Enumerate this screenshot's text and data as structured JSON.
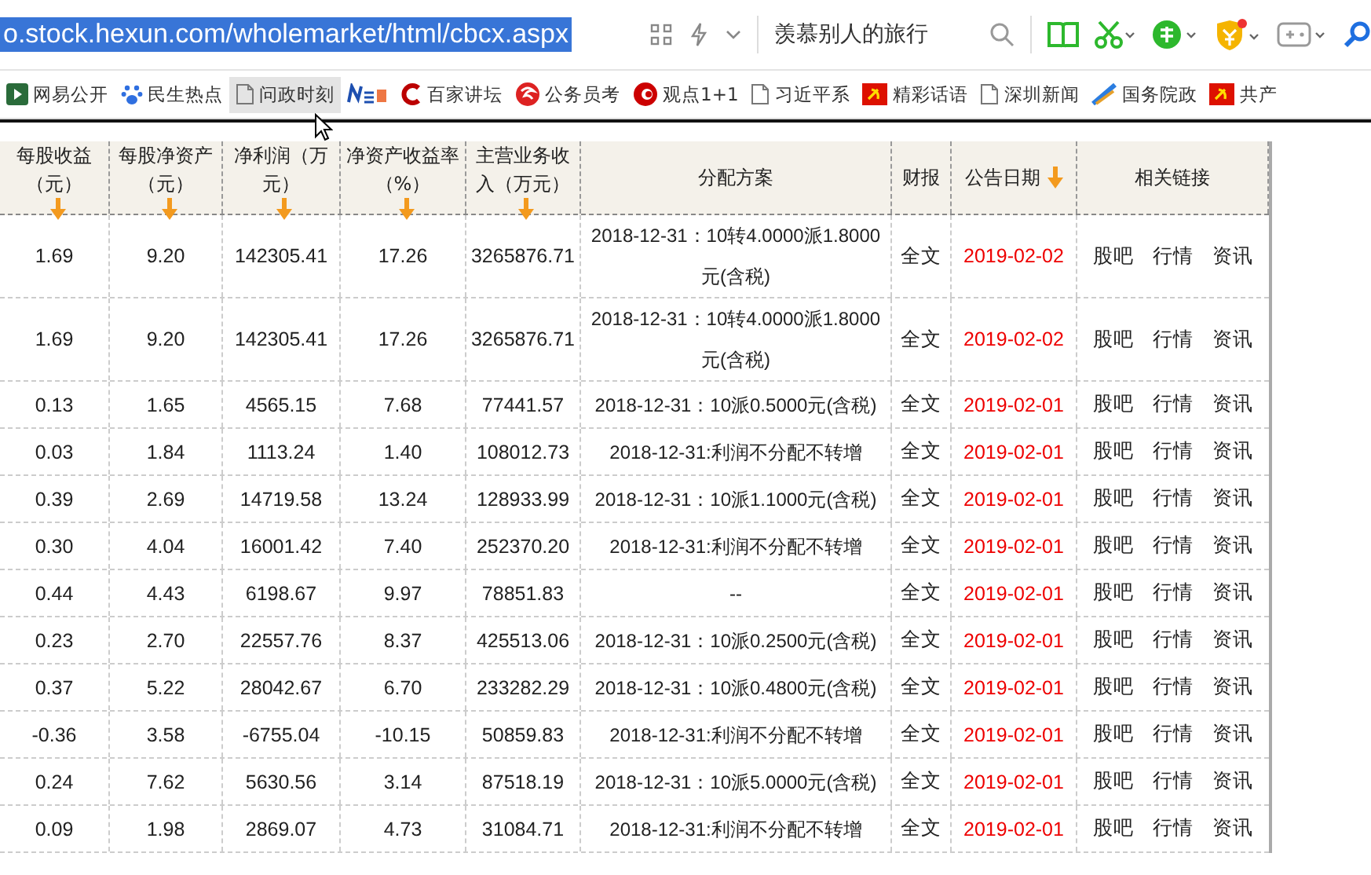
{
  "address_bar": {
    "url": "o.stock.hexun.com/wholemarket/html/cbcx.aspx",
    "url_selected": true,
    "search_text": "羡慕别人的旅行"
  },
  "bookmarks": [
    {
      "label": "网易公开",
      "kind": "play",
      "hovered": false
    },
    {
      "label": "民生热点",
      "kind": "paw",
      "hovered": false
    },
    {
      "label": "问政时刻",
      "kind": "page",
      "hovered": true
    },
    {
      "kind": "news",
      "hovered": false
    },
    {
      "label": "百家讲坛",
      "kind": "c",
      "hovered": false
    },
    {
      "label": "公务员考",
      "kind": "swirl",
      "hovered": false
    },
    {
      "label": "观点1+1",
      "kind": "ring",
      "hovered": false
    },
    {
      "label": "习近平系",
      "kind": "page",
      "hovered": false
    },
    {
      "label": "精彩话语",
      "kind": "flag",
      "hovered": false
    },
    {
      "label": "深圳新闻",
      "kind": "page",
      "hovered": false
    },
    {
      "label": "国务院政",
      "kind": "pen",
      "hovered": false
    },
    {
      "label": "共产",
      "kind": "flag",
      "hovered": false
    }
  ],
  "table": {
    "columns": [
      {
        "label": "每股收益（元）",
        "sortable": true
      },
      {
        "label": "每股净资产（元）",
        "sortable": true
      },
      {
        "label": "净利润（万元）",
        "sortable": true
      },
      {
        "label": "净资产收益率（%）",
        "sortable": true
      },
      {
        "label": "主营业务收入（万元）",
        "sortable": true
      },
      {
        "label": "分配方案",
        "sortable": false
      },
      {
        "label": "财报",
        "sortable": false
      },
      {
        "label": "公告日期",
        "sortable": true
      },
      {
        "label": "相关链接",
        "sortable": false
      }
    ],
    "rows": [
      {
        "cells": [
          "1.69",
          "9.20",
          "142305.41",
          "17.26",
          "3265876.71",
          "2018-12-31：10转4.0000派1.8000元(含税)"
        ],
        "report": "全文",
        "date": "2019-02-02",
        "links": [
          "股吧",
          "行情",
          "资讯"
        ]
      },
      {
        "cells": [
          "1.69",
          "9.20",
          "142305.41",
          "17.26",
          "3265876.71",
          "2018-12-31：10转4.0000派1.8000元(含税)"
        ],
        "report": "全文",
        "date": "2019-02-02",
        "links": [
          "股吧",
          "行情",
          "资讯"
        ]
      },
      {
        "cells": [
          "0.13",
          "1.65",
          "4565.15",
          "7.68",
          "77441.57",
          "2018-12-31：10派0.5000元(含税)"
        ],
        "report": "全文",
        "date": "2019-02-01",
        "links": [
          "股吧",
          "行情",
          "资讯"
        ]
      },
      {
        "cells": [
          "0.03",
          "1.84",
          "1113.24",
          "1.40",
          "108012.73",
          "2018-12-31:利润不分配不转增"
        ],
        "report": "全文",
        "date": "2019-02-01",
        "links": [
          "股吧",
          "行情",
          "资讯"
        ]
      },
      {
        "cells": [
          "0.39",
          "2.69",
          "14719.58",
          "13.24",
          "128933.99",
          "2018-12-31：10派1.1000元(含税)"
        ],
        "report": "全文",
        "date": "2019-02-01",
        "links": [
          "股吧",
          "行情",
          "资讯"
        ]
      },
      {
        "cells": [
          "0.30",
          "4.04",
          "16001.42",
          "7.40",
          "252370.20",
          "2018-12-31:利润不分配不转增"
        ],
        "report": "全文",
        "date": "2019-02-01",
        "links": [
          "股吧",
          "行情",
          "资讯"
        ]
      },
      {
        "cells": [
          "0.44",
          "4.43",
          "6198.67",
          "9.97",
          "78851.83",
          "--"
        ],
        "report": "全文",
        "date": "2019-02-01",
        "links": [
          "股吧",
          "行情",
          "资讯"
        ]
      },
      {
        "cells": [
          "0.23",
          "2.70",
          "22557.76",
          "8.37",
          "425513.06",
          "2018-12-31：10派0.2500元(含税)"
        ],
        "report": "全文",
        "date": "2019-02-01",
        "links": [
          "股吧",
          "行情",
          "资讯"
        ]
      },
      {
        "cells": [
          "0.37",
          "5.22",
          "28042.67",
          "6.70",
          "233282.29",
          "2018-12-31：10派0.4800元(含税)"
        ],
        "report": "全文",
        "date": "2019-02-01",
        "links": [
          "股吧",
          "行情",
          "资讯"
        ]
      },
      {
        "cells": [
          "-0.36",
          "3.58",
          "-6755.04",
          "-10.15",
          "50859.83",
          "2018-12-31:利润不分配不转增"
        ],
        "report": "全文",
        "date": "2019-02-01",
        "links": [
          "股吧",
          "行情",
          "资讯"
        ]
      },
      {
        "cells": [
          "0.24",
          "7.62",
          "5630.56",
          "3.14",
          "87518.19",
          "2018-12-31：10派5.0000元(含税)"
        ],
        "report": "全文",
        "date": "2019-02-01",
        "links": [
          "股吧",
          "行情",
          "资讯"
        ]
      },
      {
        "cells": [
          "0.09",
          "1.98",
          "2869.07",
          "4.73",
          "31084.71",
          "2018-12-31:利润不分配不转增"
        ],
        "report": "全文",
        "date": "2019-02-01",
        "links": [
          "股吧",
          "行情",
          "资讯"
        ]
      }
    ]
  }
}
